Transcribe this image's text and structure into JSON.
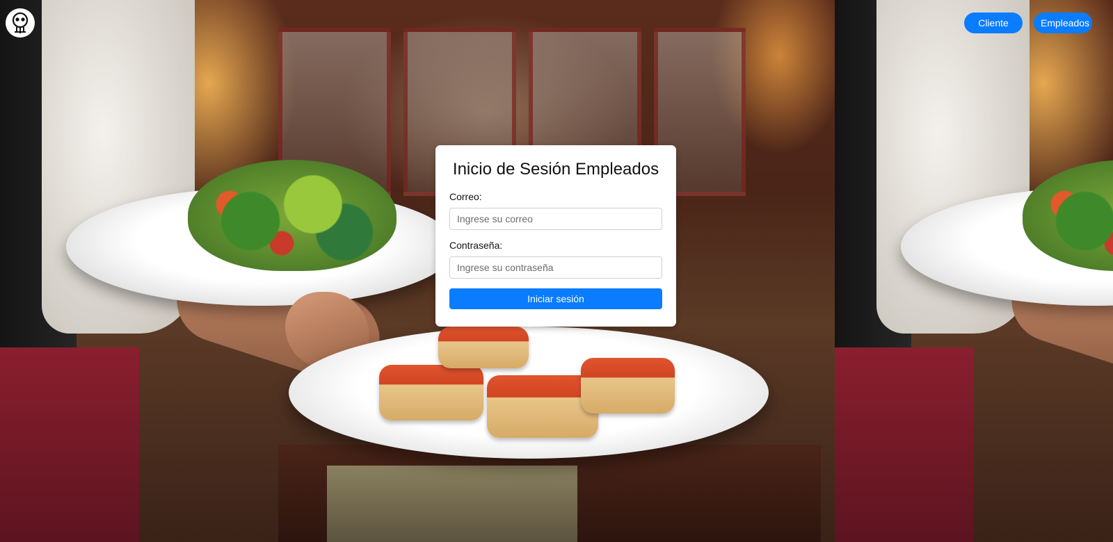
{
  "header": {
    "logo_icon": "skull-chef-logo-icon",
    "nav": {
      "cliente_label": "Cliente",
      "empleados_label": "Empleados"
    }
  },
  "login": {
    "title": "Inicio de Sesión Empleados",
    "email_label": "Correo:",
    "email_placeholder": "Ingrese su correo",
    "email_value": "",
    "password_label": "Contraseña:",
    "password_placeholder": "Ingrese su contraseña",
    "password_value": "",
    "submit_label": "Iniciar sesión"
  },
  "colors": {
    "accent": "#0a7cff",
    "card_background": "#ffffff"
  },
  "background": {
    "image": "restaurant-waiter-serving-salad-and-bruschetta-photo"
  }
}
